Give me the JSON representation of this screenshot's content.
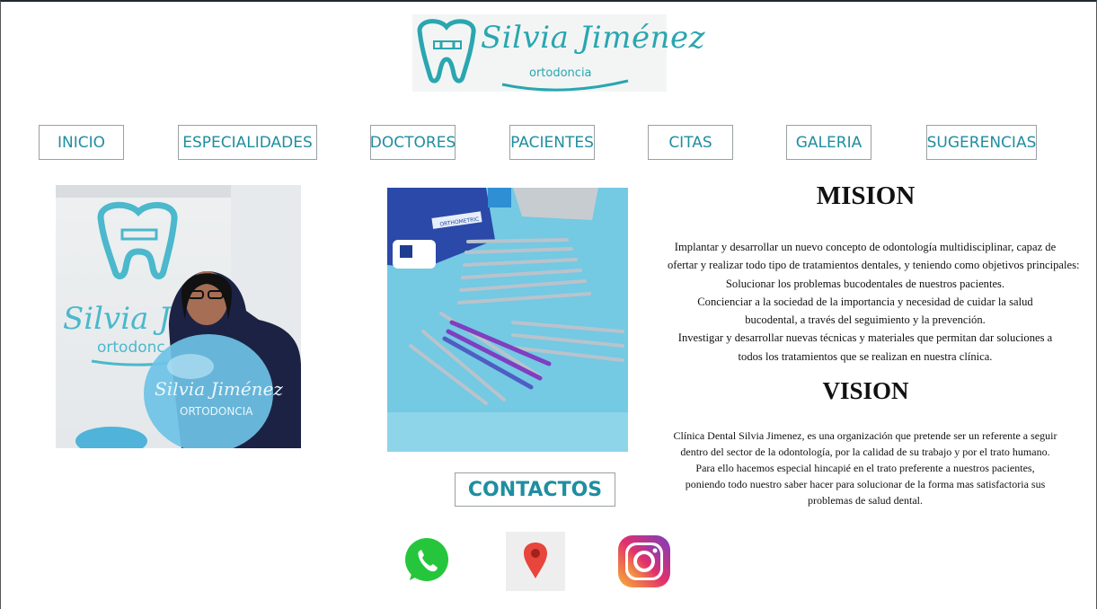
{
  "logo": {
    "name": "Silvia Jiménez",
    "tagline": "ortodoncia"
  },
  "nav": {
    "items": [
      {
        "label": "INICIO"
      },
      {
        "label": "ESPECIALIDADES"
      },
      {
        "label": "DOCTORES"
      },
      {
        "label": "PACIENTES"
      },
      {
        "label": "CITAS"
      },
      {
        "label": "GALERIA"
      },
      {
        "label": "SUGERENCIAS"
      }
    ]
  },
  "photos": {
    "photo1": {
      "logo_name": "Silvia Jim",
      "logo_tag": "ortodonc",
      "balloon_name": "Silvia Jiménez",
      "balloon_tag": "ORTODONCIA"
    },
    "photo2": {
      "tray_label": "ORTHOMETRIC"
    }
  },
  "mision": {
    "title": "MISION",
    "lines": [
      "Implantar y desarrollar un nuevo concepto de odontología multidisciplinar, capaz de",
      "ofertar y realizar todo tipo de tratamientos dentales, y teniendo como objetivos principales:",
      "Solucionar los problemas bucodentales de nuestros pacientes.",
      "Concienciar a la sociedad de la importancia y necesidad de cuidar la salud",
      "bucodental, a través del seguimiento y la prevención.",
      "Investigar y desarrollar nuevas técnicas y materiales que permitan dar soluciones a",
      "todos los tratamientos que se realizan en nuestra clínica."
    ]
  },
  "vision": {
    "title": "VISION",
    "lines": [
      "Clínica Dental Silvia Jimenez, es una organización que pretende ser un referente a seguir",
      "dentro del sector de la odontología, por la calidad de su trabajo y por el trato humano.",
      "Para ello hacemos especial hincapié en el trato preferente a nuestros pacientes,",
      "poniendo todo nuestro saber hacer para solucionar de la forma mas satisfactoria sus",
      "problemas de salud dental."
    ]
  },
  "contact": {
    "label": "CONTACTOS"
  },
  "social": {
    "whatsapp": {
      "icon": "whatsapp-icon",
      "color": "#25c63c"
    },
    "maps": {
      "icon": "map-pin-icon",
      "color": "#e8453c"
    },
    "instagram": {
      "icon": "instagram-icon",
      "color": "#c13584"
    }
  },
  "colors": {
    "accent": "#1f8ea0",
    "brand": "#2aa6b0"
  }
}
